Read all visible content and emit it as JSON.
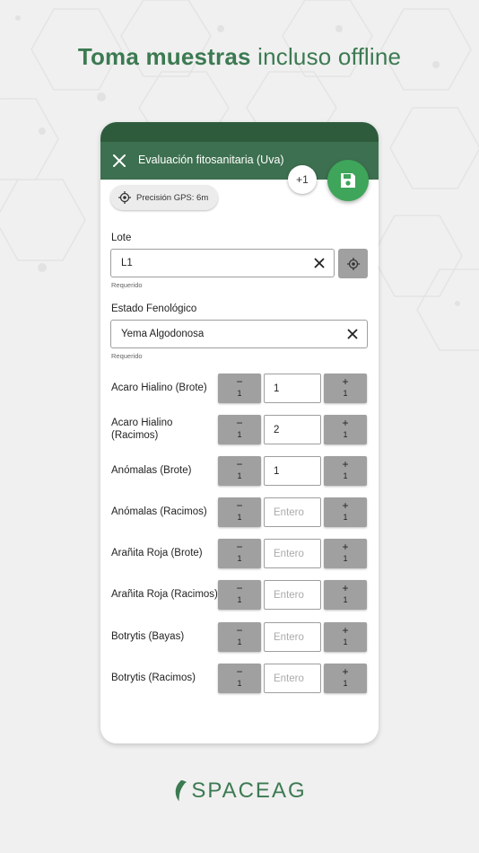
{
  "headline": {
    "bold": "Toma muestras",
    "rest": "incluso offline"
  },
  "colors": {
    "brand_green": "#3c7a52",
    "appbar": "#3d7050",
    "fab": "#3ea55a"
  },
  "appbar": {
    "title": "Evaluación fitosanitaria (Uva)",
    "close_icon": "close-icon"
  },
  "gps": {
    "label": "Precisión GPS: 6m",
    "icon": "gps-target-icon"
  },
  "badge": {
    "count": "+1"
  },
  "save": {
    "icon": "save-icon"
  },
  "lote": {
    "label": "Lote",
    "value": "L1",
    "help": "Requerido"
  },
  "estado": {
    "label": "Estado Fenológico",
    "value": "Yema Algodonosa",
    "help": "Requerido"
  },
  "stepper": {
    "minus": "−",
    "plus": "+",
    "step": "1",
    "placeholder": "Entero"
  },
  "rows": [
    {
      "label": "Acaro Hialino (Brote)",
      "value": "1"
    },
    {
      "label": "Acaro Hialino (Racimos)",
      "value": "2"
    },
    {
      "label": "Anómalas (Brote)",
      "value": "1"
    },
    {
      "label": "Anómalas (Racimos)",
      "value": ""
    },
    {
      "label": "Arañita Roja (Brote)",
      "value": ""
    },
    {
      "label": "Arañita Roja (Racimos)",
      "value": ""
    },
    {
      "label": "Botrytis (Bayas)",
      "value": ""
    },
    {
      "label": "Botrytis (Racimos)",
      "value": ""
    }
  ],
  "brand": {
    "name": "SPACEAG",
    "icon": "leaf-icon"
  }
}
